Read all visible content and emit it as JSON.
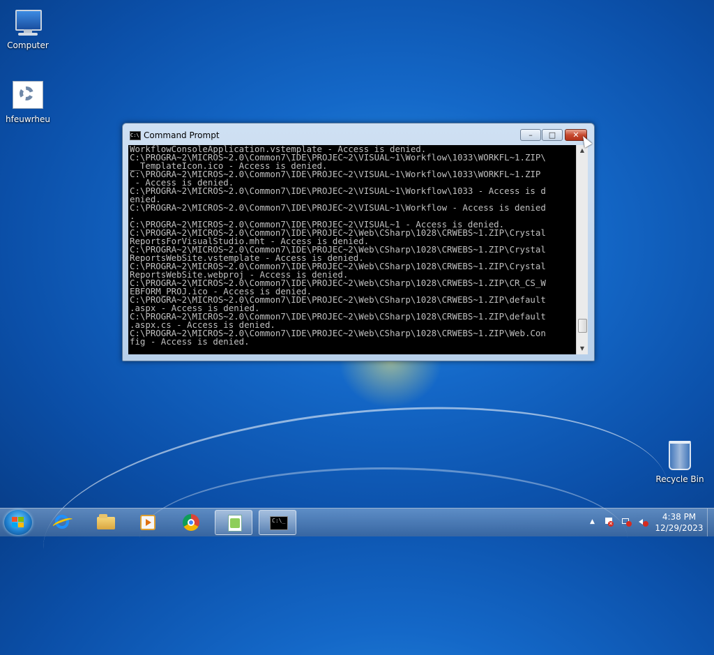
{
  "desktop": {
    "icons": [
      {
        "label": "Computer"
      },
      {
        "label": "hfeuwrheu"
      },
      {
        "label": "Recycle Bin"
      }
    ]
  },
  "window": {
    "title": "Command Prompt",
    "title_icon_text": "C:\\",
    "controls": {
      "minimize": "minimize-icon",
      "maximize": "maximize-icon",
      "close": "close-icon"
    },
    "console_lines": [
      "WorkflowConsoleApplication.vstemplate - Access is denied.",
      "C:\\PROGRA~2\\MICROS~2.0\\Common7\\IDE\\PROJEC~2\\VISUAL~1\\Workflow\\1033\\WORKFL~1.ZIP\\",
      "__TemplateIcon.ico - Access is denied.",
      "C:\\PROGRA~2\\MICROS~2.0\\Common7\\IDE\\PROJEC~2\\VISUAL~1\\Workflow\\1033\\WORKFL~1.ZIP",
      " - Access is denied.",
      "C:\\PROGRA~2\\MICROS~2.0\\Common7\\IDE\\PROJEC~2\\VISUAL~1\\Workflow\\1033 - Access is d",
      "enied.",
      "C:\\PROGRA~2\\MICROS~2.0\\Common7\\IDE\\PROJEC~2\\VISUAL~1\\Workflow - Access is denied",
      ".",
      "C:\\PROGRA~2\\MICROS~2.0\\Common7\\IDE\\PROJEC~2\\VISUAL~1 - Access is denied.",
      "C:\\PROGRA~2\\MICROS~2.0\\Common7\\IDE\\PROJEC~2\\Web\\CSharp\\1028\\CRWEBS~1.ZIP\\Crystal",
      "ReportsForVisualStudio.mht - Access is denied.",
      "C:\\PROGRA~2\\MICROS~2.0\\Common7\\IDE\\PROJEC~2\\Web\\CSharp\\1028\\CRWEBS~1.ZIP\\Crystal",
      "ReportsWebSite.vstemplate - Access is denied.",
      "C:\\PROGRA~2\\MICROS~2.0\\Common7\\IDE\\PROJEC~2\\Web\\CSharp\\1028\\CRWEBS~1.ZIP\\Crystal",
      "ReportsWebSite.webproj - Access is denied.",
      "C:\\PROGRA~2\\MICROS~2.0\\Common7\\IDE\\PROJEC~2\\Web\\CSharp\\1028\\CRWEBS~1.ZIP\\CR_CS_W",
      "EBFORM_PROJ.ico - Access is denied.",
      "C:\\PROGRA~2\\MICROS~2.0\\Common7\\IDE\\PROJEC~2\\Web\\CSharp\\1028\\CRWEBS~1.ZIP\\default",
      ".aspx - Access is denied.",
      "C:\\PROGRA~2\\MICROS~2.0\\Common7\\IDE\\PROJEC~2\\Web\\CSharp\\1028\\CRWEBS~1.ZIP\\default",
      ".aspx.cs - Access is denied.",
      "C:\\PROGRA~2\\MICROS~2.0\\Common7\\IDE\\PROJEC~2\\Web\\CSharp\\1028\\CRWEBS~1.ZIP\\Web.Con",
      "fig - Access is denied."
    ],
    "scroll_position": 0.93
  },
  "taskbar": {
    "buttons": [
      {
        "name": "internet-explorer-icon",
        "active": false
      },
      {
        "name": "file-explorer-icon",
        "active": false
      },
      {
        "name": "media-player-icon",
        "active": false
      },
      {
        "name": "chrome-icon",
        "active": false
      },
      {
        "name": "notepad-plus-plus-icon",
        "active": true
      },
      {
        "name": "command-prompt-icon",
        "active": true
      }
    ],
    "tray": {
      "show_hidden": "▲",
      "clock_time": "4:38 PM",
      "clock_date": "12/29/2023"
    }
  },
  "colors": {
    "console_bg": "#000000",
    "console_fg": "#c0c0c0",
    "close_button": "#c74a30"
  }
}
